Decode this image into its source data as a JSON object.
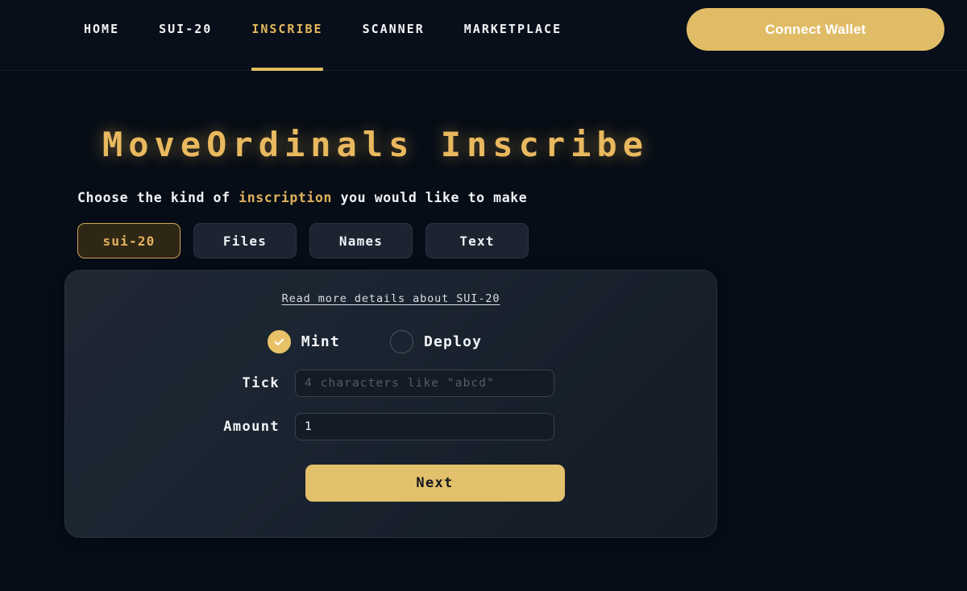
{
  "header": {
    "nav": [
      {
        "label": "HOME",
        "active": false
      },
      {
        "label": "SUI-20",
        "active": false
      },
      {
        "label": "INSCRIBE",
        "active": true
      },
      {
        "label": "SCANNER",
        "active": false
      },
      {
        "label": "MARKETPLACE",
        "active": false
      }
    ],
    "connect_wallet_label": "Connect Wallet"
  },
  "main": {
    "title": "MoveOrdinals Inscribe",
    "subtitle_prefix": "Choose the kind of ",
    "subtitle_highlight": "inscription",
    "subtitle_suffix": " you would like to make",
    "kinds": [
      {
        "label": "sui-20",
        "active": true
      },
      {
        "label": "Files",
        "active": false
      },
      {
        "label": "Names",
        "active": false
      },
      {
        "label": "Text",
        "active": false
      }
    ]
  },
  "card": {
    "read_more_label": "Read more details about SUI-20",
    "modes": [
      {
        "label": "Mint",
        "selected": true
      },
      {
        "label": "Deploy",
        "selected": false
      }
    ],
    "fields": [
      {
        "label": "Tick",
        "value": "",
        "placeholder": "4 characters like \"abcd\""
      },
      {
        "label": "Amount",
        "value": "1",
        "placeholder": ""
      }
    ],
    "submit_label": "Next"
  },
  "colors": {
    "background": "#060d17",
    "accent_gold": "#e3bb63",
    "card_surface": "#1b2531",
    "text_primary": "#f2f4f7",
    "text_muted": "#545d6a"
  }
}
